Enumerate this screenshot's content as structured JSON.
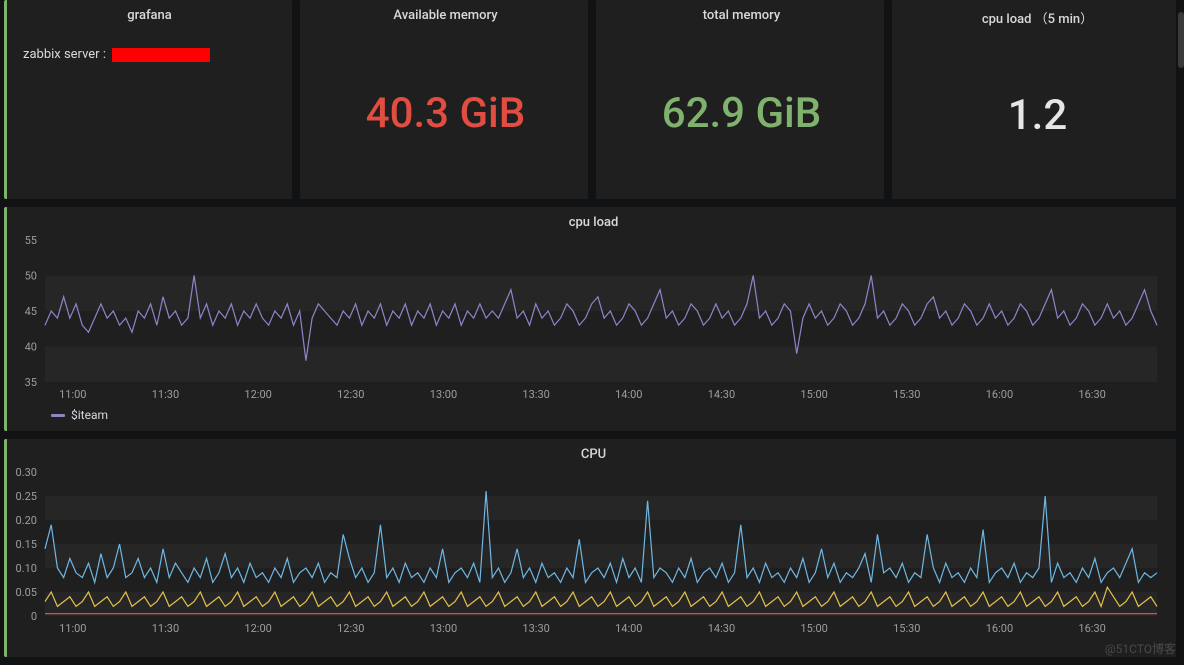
{
  "panels": {
    "info": {
      "title": "grafana",
      "label": "zabbix server :"
    },
    "stat_avail": {
      "title": "Available memory",
      "value": "40.3 GiB",
      "colorClass": "red"
    },
    "stat_total": {
      "title": "total memory",
      "value": "62.9 GiB",
      "colorClass": "green"
    },
    "stat_cpu5": {
      "title": "cpu load （5 min）",
      "value": "1.2",
      "colorClass": "white"
    },
    "chart_load": {
      "title": "cpu load",
      "legend": "$iteam"
    },
    "chart_cpu": {
      "title": "CPU"
    }
  },
  "watermark": "@51CTO博客",
  "colors": {
    "series_purple": "#8e85c9",
    "series_blue": "#6fb7e3",
    "series_yellow": "#e5c04b",
    "series_red": "#e24d42"
  },
  "chart_data": [
    {
      "id": "chart_load",
      "type": "line",
      "title": "cpu load",
      "ylabel": "",
      "ylim": [
        35,
        55
      ],
      "yticks": [
        35,
        40,
        45,
        50,
        55
      ],
      "xlabels": [
        "11:00",
        "11:30",
        "12:00",
        "12:30",
        "13:00",
        "13:30",
        "14:00",
        "14:30",
        "15:00",
        "15:30",
        "16:00",
        "16:30"
      ],
      "legend": [
        "$iteam"
      ],
      "series": [
        {
          "name": "$iteam",
          "color": "#8e85c9",
          "values": [
            43,
            45,
            44,
            47,
            44,
            46,
            43,
            42,
            44,
            46,
            44,
            45,
            43,
            44,
            42,
            45,
            44,
            46,
            43,
            47,
            44,
            45,
            43,
            44,
            50,
            44,
            46,
            43,
            45,
            44,
            46,
            43,
            45,
            44,
            46,
            44,
            43,
            45,
            44,
            46,
            43,
            45,
            38,
            44,
            46,
            45,
            44,
            43,
            45,
            44,
            46,
            43,
            45,
            44,
            46,
            43,
            45,
            44,
            46,
            43,
            45,
            44,
            46,
            43,
            45,
            44,
            46,
            43,
            45,
            44,
            46,
            44,
            45,
            44,
            46,
            48,
            44,
            45,
            43,
            46,
            44,
            45,
            43,
            44,
            46,
            45,
            43,
            44,
            46,
            47,
            44,
            45,
            43,
            44,
            46,
            45,
            43,
            44,
            46,
            48,
            44,
            45,
            43,
            44,
            46,
            45,
            43,
            44,
            46,
            44,
            45,
            43,
            44,
            46,
            50,
            44,
            45,
            43,
            44,
            46,
            45,
            39,
            44,
            46,
            44,
            45,
            43,
            44,
            46,
            45,
            43,
            44,
            46,
            50,
            44,
            45,
            43,
            44,
            46,
            45,
            43,
            44,
            46,
            47,
            44,
            45,
            43,
            44,
            46,
            45,
            43,
            44,
            46,
            44,
            45,
            43,
            44,
            46,
            45,
            43,
            44,
            46,
            48,
            44,
            45,
            43,
            44,
            46,
            45,
            43,
            44,
            46,
            44,
            45,
            43,
            44,
            46,
            48,
            45,
            43
          ]
        }
      ]
    },
    {
      "id": "chart_cpu",
      "type": "line",
      "title": "CPU",
      "ylabel": "",
      "ylim": [
        0,
        0.3
      ],
      "yticks": [
        0,
        0.05,
        0.1,
        0.15,
        0.2,
        0.25,
        0.3
      ],
      "xlabels": [
        "11:00",
        "11:30",
        "12:00",
        "12:30",
        "13:00",
        "13:30",
        "14:00",
        "14:30",
        "15:00",
        "15:30",
        "16:00",
        "16:30"
      ],
      "series": [
        {
          "name": "blue",
          "color": "#6fb7e3",
          "values": [
            0.14,
            0.19,
            0.1,
            0.08,
            0.12,
            0.09,
            0.08,
            0.11,
            0.07,
            0.13,
            0.08,
            0.1,
            0.15,
            0.08,
            0.09,
            0.12,
            0.08,
            0.1,
            0.07,
            0.14,
            0.08,
            0.11,
            0.09,
            0.07,
            0.1,
            0.08,
            0.12,
            0.07,
            0.09,
            0.13,
            0.08,
            0.1,
            0.07,
            0.11,
            0.08,
            0.09,
            0.07,
            0.1,
            0.08,
            0.12,
            0.07,
            0.09,
            0.1,
            0.08,
            0.11,
            0.07,
            0.09,
            0.08,
            0.17,
            0.12,
            0.08,
            0.1,
            0.07,
            0.09,
            0.19,
            0.08,
            0.1,
            0.07,
            0.11,
            0.08,
            0.09,
            0.07,
            0.1,
            0.08,
            0.14,
            0.07,
            0.09,
            0.1,
            0.08,
            0.11,
            0.07,
            0.26,
            0.08,
            0.1,
            0.07,
            0.09,
            0.14,
            0.08,
            0.1,
            0.07,
            0.11,
            0.08,
            0.09,
            0.07,
            0.1,
            0.08,
            0.16,
            0.07,
            0.09,
            0.1,
            0.08,
            0.11,
            0.07,
            0.12,
            0.08,
            0.1,
            0.07,
            0.24,
            0.08,
            0.1,
            0.09,
            0.07,
            0.1,
            0.08,
            0.12,
            0.07,
            0.09,
            0.1,
            0.08,
            0.11,
            0.07,
            0.09,
            0.19,
            0.08,
            0.1,
            0.07,
            0.11,
            0.08,
            0.09,
            0.07,
            0.1,
            0.08,
            0.12,
            0.07,
            0.09,
            0.14,
            0.08,
            0.11,
            0.07,
            0.09,
            0.08,
            0.1,
            0.13,
            0.07,
            0.17,
            0.09,
            0.1,
            0.08,
            0.11,
            0.07,
            0.09,
            0.08,
            0.17,
            0.1,
            0.07,
            0.11,
            0.08,
            0.09,
            0.07,
            0.1,
            0.08,
            0.18,
            0.07,
            0.09,
            0.1,
            0.08,
            0.11,
            0.07,
            0.09,
            0.08,
            0.1,
            0.25,
            0.07,
            0.11,
            0.08,
            0.09,
            0.07,
            0.1,
            0.08,
            0.12,
            0.07,
            0.09,
            0.1,
            0.08,
            0.11,
            0.14,
            0.07,
            0.09,
            0.08,
            0.09
          ]
        },
        {
          "name": "yellow",
          "color": "#e5c04b",
          "values": [
            0.03,
            0.05,
            0.02,
            0.03,
            0.04,
            0.02,
            0.03,
            0.05,
            0.02,
            0.03,
            0.04,
            0.02,
            0.03,
            0.05,
            0.02,
            0.03,
            0.04,
            0.02,
            0.03,
            0.05,
            0.02,
            0.03,
            0.04,
            0.02,
            0.03,
            0.05,
            0.02,
            0.03,
            0.04,
            0.02,
            0.03,
            0.05,
            0.02,
            0.03,
            0.04,
            0.02,
            0.03,
            0.05,
            0.02,
            0.03,
            0.04,
            0.02,
            0.03,
            0.05,
            0.02,
            0.03,
            0.04,
            0.02,
            0.03,
            0.05,
            0.02,
            0.03,
            0.04,
            0.02,
            0.03,
            0.05,
            0.02,
            0.03,
            0.04,
            0.02,
            0.03,
            0.05,
            0.02,
            0.03,
            0.04,
            0.02,
            0.03,
            0.05,
            0.02,
            0.03,
            0.04,
            0.02,
            0.03,
            0.05,
            0.02,
            0.03,
            0.04,
            0.02,
            0.03,
            0.05,
            0.02,
            0.03,
            0.04,
            0.02,
            0.03,
            0.05,
            0.02,
            0.03,
            0.04,
            0.02,
            0.03,
            0.05,
            0.02,
            0.03,
            0.04,
            0.02,
            0.03,
            0.05,
            0.02,
            0.03,
            0.04,
            0.02,
            0.03,
            0.05,
            0.02,
            0.03,
            0.04,
            0.02,
            0.03,
            0.05,
            0.02,
            0.03,
            0.04,
            0.02,
            0.03,
            0.05,
            0.02,
            0.03,
            0.04,
            0.02,
            0.03,
            0.05,
            0.02,
            0.03,
            0.04,
            0.02,
            0.03,
            0.05,
            0.02,
            0.03,
            0.04,
            0.02,
            0.03,
            0.05,
            0.02,
            0.03,
            0.04,
            0.02,
            0.03,
            0.05,
            0.02,
            0.03,
            0.04,
            0.02,
            0.03,
            0.05,
            0.02,
            0.03,
            0.04,
            0.02,
            0.03,
            0.05,
            0.02,
            0.03,
            0.04,
            0.02,
            0.03,
            0.05,
            0.02,
            0.03,
            0.04,
            0.02,
            0.03,
            0.05,
            0.02,
            0.03,
            0.04,
            0.02,
            0.03,
            0.05,
            0.02,
            0.06,
            0.04,
            0.02,
            0.03,
            0.05,
            0.02,
            0.03,
            0.04,
            0.02
          ]
        },
        {
          "name": "red",
          "color": "#e24d42",
          "values": [
            0.005,
            0.005,
            0.005,
            0.005,
            0.005,
            0.005,
            0.005,
            0.005,
            0.005,
            0.005,
            0.005,
            0.005,
            0.005,
            0.005,
            0.005,
            0.005,
            0.005,
            0.005,
            0.005,
            0.005,
            0.005,
            0.005,
            0.005,
            0.005,
            0.005,
            0.005,
            0.005,
            0.005,
            0.005,
            0.005,
            0.005,
            0.005,
            0.005,
            0.005,
            0.005,
            0.005,
            0.005,
            0.005,
            0.005,
            0.005,
            0.005,
            0.005,
            0.005,
            0.005,
            0.005,
            0.005,
            0.005,
            0.005,
            0.005,
            0.005,
            0.005,
            0.005,
            0.005,
            0.005,
            0.005,
            0.005,
            0.005,
            0.005,
            0.005,
            0.005,
            0.005,
            0.005,
            0.005,
            0.005,
            0.005,
            0.005,
            0.005,
            0.005,
            0.005,
            0.005,
            0.005,
            0.005,
            0.005,
            0.005,
            0.005,
            0.005,
            0.005,
            0.005,
            0.005,
            0.005,
            0.005,
            0.005,
            0.005,
            0.005,
            0.005,
            0.005,
            0.005,
            0.005,
            0.005,
            0.005,
            0.005,
            0.005,
            0.005,
            0.005,
            0.005,
            0.005,
            0.005,
            0.005,
            0.005,
            0.005,
            0.005,
            0.005,
            0.005,
            0.005,
            0.005,
            0.005,
            0.005,
            0.005,
            0.005,
            0.005,
            0.005,
            0.005,
            0.005,
            0.005,
            0.005,
            0.005,
            0.005,
            0.005,
            0.005,
            0.005,
            0.005,
            0.005,
            0.005,
            0.005,
            0.005,
            0.005,
            0.005,
            0.005,
            0.005,
            0.005,
            0.005,
            0.005,
            0.005,
            0.005,
            0.005,
            0.005,
            0.005,
            0.005,
            0.005,
            0.005,
            0.005,
            0.005,
            0.005,
            0.005,
            0.005,
            0.005,
            0.005,
            0.005,
            0.005,
            0.005,
            0.005,
            0.005,
            0.005,
            0.005,
            0.005,
            0.005,
            0.005,
            0.005,
            0.005,
            0.005,
            0.005,
            0.005,
            0.005,
            0.005,
            0.005,
            0.005,
            0.005,
            0.005,
            0.005,
            0.005,
            0.005,
            0.005,
            0.005,
            0.005,
            0.005,
            0.005,
            0.005,
            0.005,
            0.005,
            0.005
          ]
        }
      ]
    }
  ]
}
